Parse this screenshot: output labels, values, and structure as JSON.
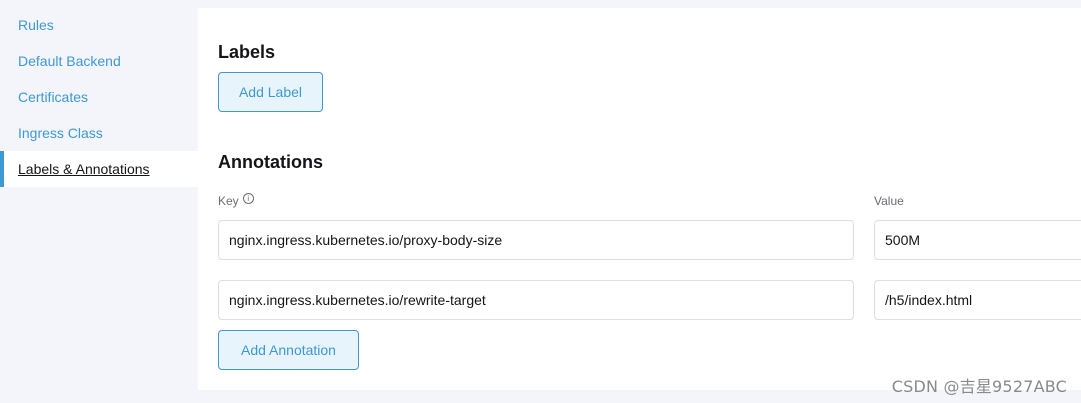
{
  "sidebar": {
    "items": [
      {
        "label": "Rules"
      },
      {
        "label": "Default Backend"
      },
      {
        "label": "Certificates"
      },
      {
        "label": "Ingress Class"
      },
      {
        "label": "Labels & Annotations",
        "active": true
      }
    ]
  },
  "labels_section": {
    "title": "Labels",
    "add_label_button": "Add Label"
  },
  "annotations_section": {
    "title": "Annotations",
    "key_header": "Key",
    "value_header": "Value",
    "rows": [
      {
        "key": "nginx.ingress.kubernetes.io/proxy-body-size",
        "value": "500M"
      },
      {
        "key": "nginx.ingress.kubernetes.io/rewrite-target",
        "value": "/h5/index.html"
      }
    ],
    "add_annotation_button": "Add Annotation"
  },
  "watermark": "CSDN @吉星9527ABC",
  "colors": {
    "accent": "#3d98d3",
    "sidebar_bg": "#f4f5fa",
    "button_bg": "#e8f4fb",
    "border": "#dcdee7"
  },
  "icons": {
    "key_info": "info-icon"
  }
}
